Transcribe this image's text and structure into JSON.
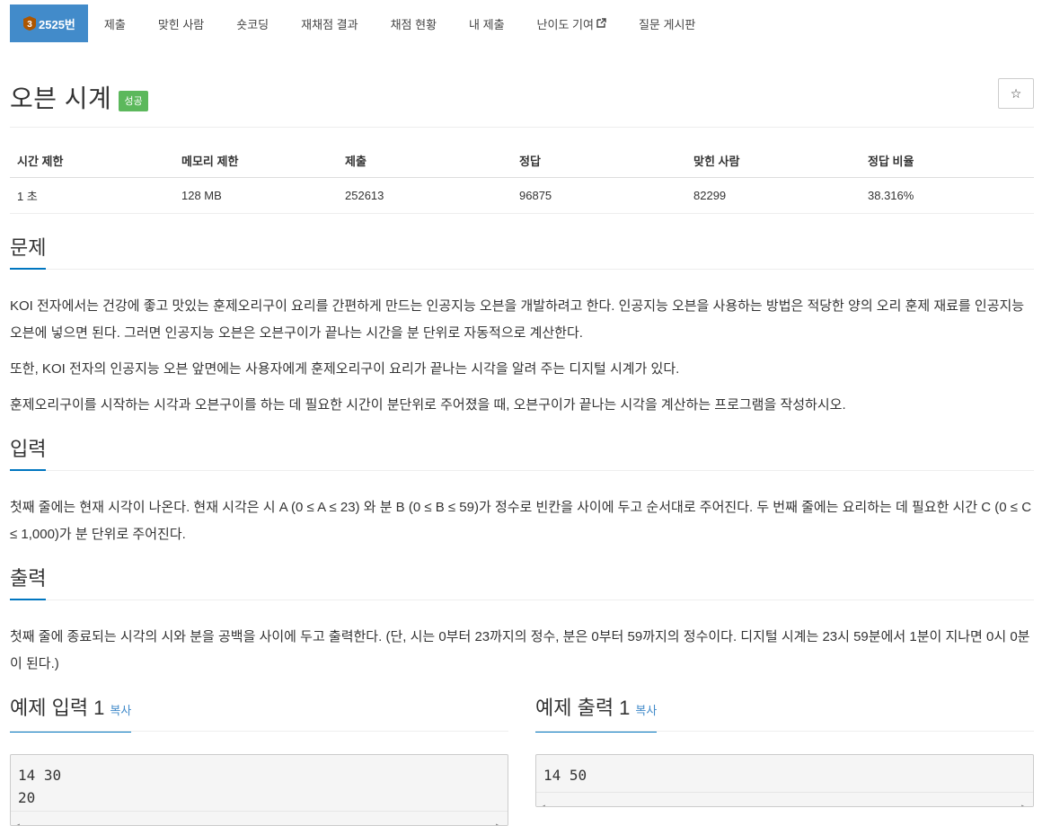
{
  "nav": {
    "problem_tab": "2525번",
    "tier_number": "3",
    "items": [
      "제출",
      "맞힌 사람",
      "숏코딩",
      "재채점 결과",
      "채점 현황",
      "내 제출",
      "난이도 기여",
      "질문 게시판"
    ]
  },
  "title": "오븐 시계",
  "badge": "성공",
  "star_icon": "☆",
  "info": {
    "headers": [
      "시간 제한",
      "메모리 제한",
      "제출",
      "정답",
      "맞힌 사람",
      "정답 비율"
    ],
    "values": [
      "1 초",
      "128 MB",
      "252613",
      "96875",
      "82299",
      "38.316%"
    ]
  },
  "problem": {
    "heading": "문제",
    "p1": "KOI 전자에서는 건강에 좋고 맛있는 훈제오리구이 요리를 간편하게 만드는 인공지능 오븐을 개발하려고 한다. 인공지능 오븐을 사용하는 방법은 적당한 양의 오리 훈제 재료를 인공지능 오븐에 넣으면 된다. 그러면 인공지능 오븐은 오븐구이가 끝나는 시간을 분 단위로 자동적으로 계산한다.",
    "p2": "또한, KOI 전자의 인공지능 오븐 앞면에는 사용자에게 훈제오리구이 요리가 끝나는 시각을 알려 주는 디지털 시계가 있다.",
    "p3": "훈제오리구이를 시작하는 시각과 오븐구이를 하는 데 필요한 시간이 분단위로 주어졌을 때, 오븐구이가 끝나는 시각을 계산하는 프로그램을 작성하시오."
  },
  "input": {
    "heading": "입력",
    "text": "첫째 줄에는 현재 시각이 나온다. 현재 시각은 시 A (0 ≤ A ≤ 23) 와 분 B (0 ≤ B ≤ 59)가 정수로 빈칸을 사이에 두고 순서대로 주어진다. 두 번째 줄에는 요리하는 데 필요한 시간 C (0 ≤ C ≤ 1,000)가 분 단위로 주어진다."
  },
  "output": {
    "heading": "출력",
    "text": "첫째 줄에 종료되는 시각의 시와 분을 공백을 사이에 두고 출력한다. (단, 시는 0부터 23까지의 정수, 분은 0부터 59까지의 정수이다. 디지털 시계는 23시 59분에서 1분이 지나면 0시 0분이 된다.)"
  },
  "samples": {
    "input_label": "예제 입력 1",
    "output_label": "예제 출력 1",
    "copy": "복사",
    "input_line1": "14 30",
    "input_line2": "20",
    "output_line1": "14 50"
  },
  "colors": {
    "active_tab": "#428bca",
    "badge": "#5cb85c",
    "accent": "#0076c0"
  }
}
